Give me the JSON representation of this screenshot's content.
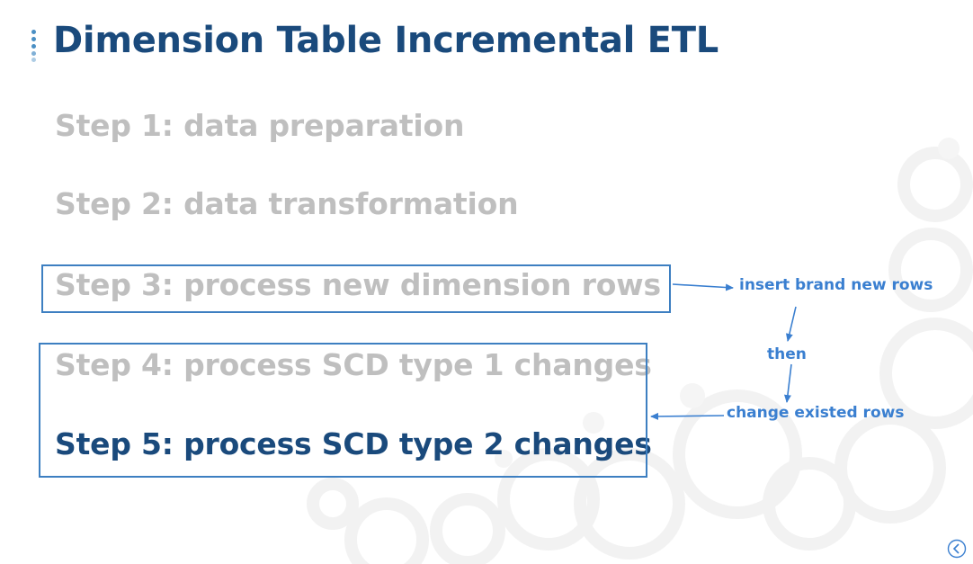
{
  "slide": {
    "title": "Dimension Table Incremental ETL",
    "steps": [
      {
        "label": "Step 1: data preparation",
        "state": "dimmed"
      },
      {
        "label": "Step 2: data transformation",
        "state": "dimmed"
      },
      {
        "label": "Step 3: process new dimension rows",
        "state": "dimmed"
      },
      {
        "label": "Step 4: process SCD type 1 changes",
        "state": "dimmed"
      },
      {
        "label": "Step 5: process SCD type 2 changes",
        "state": "active"
      }
    ],
    "annotations": {
      "insert": "insert brand new rows",
      "then": "then",
      "change": "change existed rows"
    }
  },
  "colors": {
    "title": "#1a4a7c",
    "dimmed": "#bfbfbf",
    "active": "#1a4a7c",
    "annotation": "#3a7fd0",
    "box": "#3d7fc1"
  },
  "icons": {
    "title_bullet": "vertical-dots-icon",
    "nav_back": "back-arrow-circle-icon"
  }
}
